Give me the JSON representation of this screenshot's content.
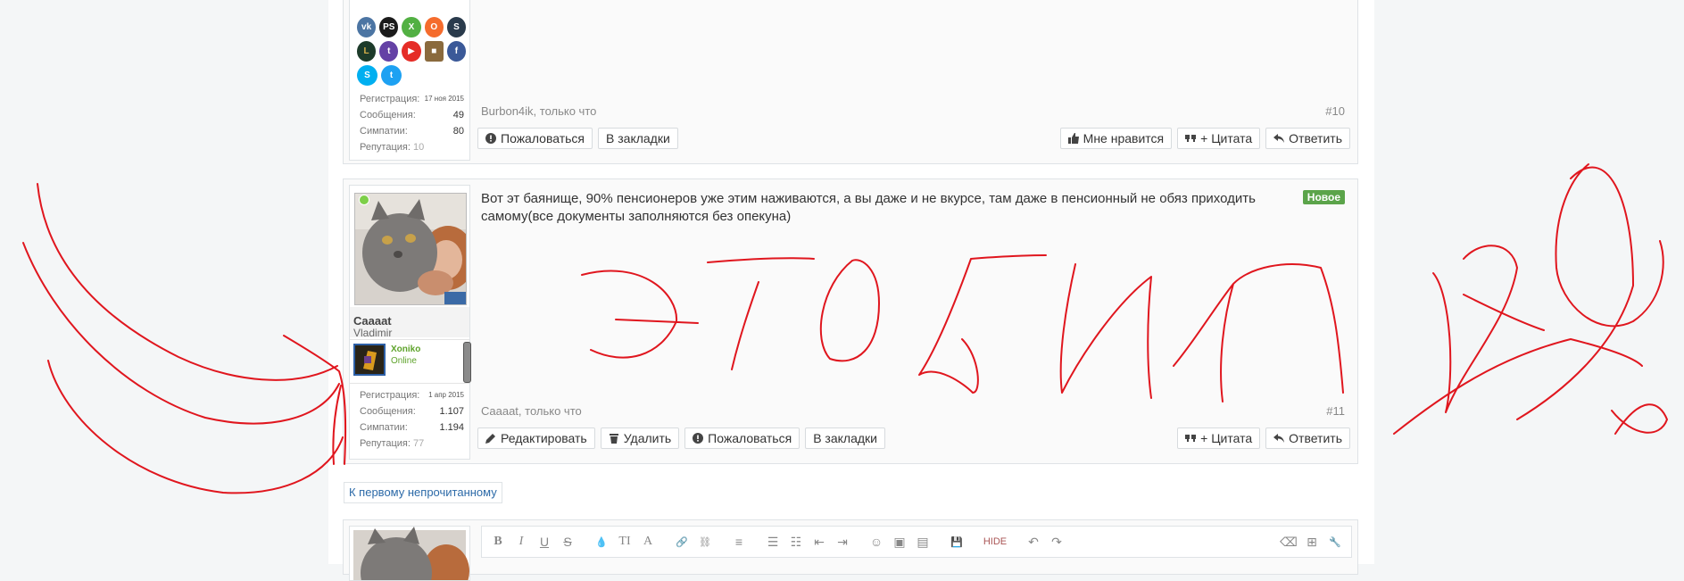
{
  "post10": {
    "stats": [
      {
        "label": "Регистрация:",
        "value": "17 ноя 2015"
      },
      {
        "label": "Сообщения:",
        "value": "49"
      },
      {
        "label": "Симпатии:",
        "value": "80"
      },
      {
        "label": "Репутация:",
        "value": "10"
      }
    ],
    "meta_author": "Burbon4ik",
    "meta_time": ", только что",
    "number": "#10",
    "left_buttons": [
      "Пожаловаться",
      "В закладки"
    ],
    "right_buttons": [
      "Мне нравится",
      "+ Цитата",
      "Ответить"
    ]
  },
  "post11": {
    "username": "Caaaat",
    "user_title": "Vladimir",
    "mini_card": {
      "name": "Xoniko",
      "status": "Online"
    },
    "stats": [
      {
        "label": "Регистрация:",
        "value": "1 апр 2015"
      },
      {
        "label": "Сообщения:",
        "value": "1.107"
      },
      {
        "label": "Симпатии:",
        "value": "1.194"
      },
      {
        "label": "Репутация:",
        "value": "77"
      }
    ],
    "message": "Вот эт баянище, 90% пенсионеров уже этим наживаются, а вы даже и не вкурсе, там даже в пенсионный не обяз приходить самому(все документы заполняются без опекуна)",
    "badge": "Новое",
    "meta_author": "Caaaat",
    "meta_time": ", только что",
    "number": "#11",
    "left_buttons": [
      "Редактировать",
      "Удалить",
      "Пожаловаться",
      "В закладки"
    ],
    "right_buttons": [
      "+ Цитата",
      "Ответить"
    ]
  },
  "unread_link": "К первому непрочитанному",
  "editor": {
    "tools": [
      "B",
      "I",
      "U",
      "S",
      "💧",
      "TI",
      "A",
      "🔗",
      "⛓",
      "≡",
      "☰",
      "☷",
      "⇤",
      "⇥",
      "☺",
      "▣",
      "▤",
      "💾",
      "HIDE",
      "↶",
      "↷",
      "⌫",
      "⊞",
      "🔧"
    ]
  },
  "colors": {
    "ink": "#e0161e",
    "online": "#5ea32b",
    "badge": "#5ba44a",
    "link": "#2c6aa8"
  }
}
